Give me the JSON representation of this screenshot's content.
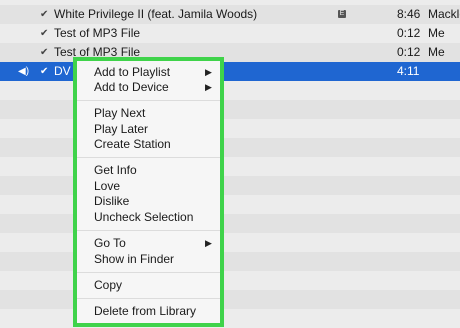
{
  "tracks": [
    {
      "name": "White Privilege II (feat. Jamila Woods)",
      "time": "8:46",
      "artist": "Mackle",
      "explicit": "E"
    },
    {
      "name": "Test of MP3 File",
      "time": "0:12",
      "artist": "Me"
    },
    {
      "name": "Test of MP3 File",
      "time": "0:12",
      "artist": "Me"
    },
    {
      "name": "DV",
      "time": "4:11",
      "artist": "",
      "selected": true
    }
  ],
  "menu": {
    "add_to_playlist": "Add to Playlist",
    "add_to_device": "Add to Device",
    "play_next": "Play Next",
    "play_later": "Play Later",
    "create_station": "Create Station",
    "get_info": "Get Info",
    "love": "Love",
    "dislike": "Dislike",
    "uncheck_selection": "Uncheck Selection",
    "go_to": "Go To",
    "show_in_finder": "Show in Finder",
    "copy": "Copy",
    "delete_from_library": "Delete from Library"
  },
  "icons": {
    "checkmark": "checkmark-icon",
    "speaker": "speaker-icon",
    "submenu": "triangle-right-icon"
  },
  "colors": {
    "selection": "#1f66d1",
    "highlight_border": "#3fd34a"
  }
}
